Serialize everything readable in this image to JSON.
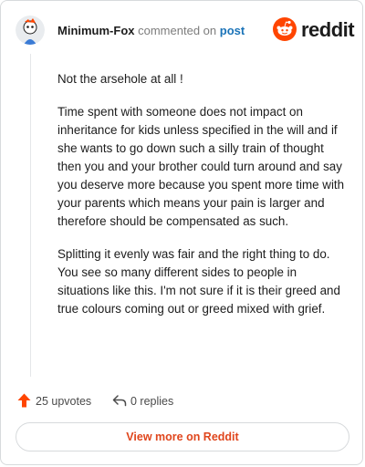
{
  "header": {
    "author": "Minimum-Fox",
    "action_text": "commented on",
    "post_link": "post",
    "brand": "reddit"
  },
  "comment": {
    "paragraphs": [
      "Not the arsehole at all !",
      "Time spent with someone does not impact on inheritance for kids unless specified in the will and if she wants to go down such a silly train of thought then you and your brother could turn around and say you deserve more because you spent more time with your parents which means your pain is larger and therefore should be compensated as such.",
      "Splitting it evenly was fair and the right thing to do. You see so many different sides to people in situations like this. I'm not sure if it is their greed and true colours coming out or greed mixed with grief."
    ]
  },
  "actions": {
    "upvotes": "25 upvotes",
    "replies": "0 replies"
  },
  "footer": {
    "view_more": "View more on Reddit"
  },
  "colors": {
    "brand_orange": "#ff4500",
    "link_blue": "#1a73b8",
    "view_more_text": "#e0461d"
  },
  "icons": {
    "avatar": "user-avatar",
    "brand": "reddit-logo-icon",
    "upvote": "upvote-arrow-icon",
    "reply": "reply-arrow-icon"
  }
}
